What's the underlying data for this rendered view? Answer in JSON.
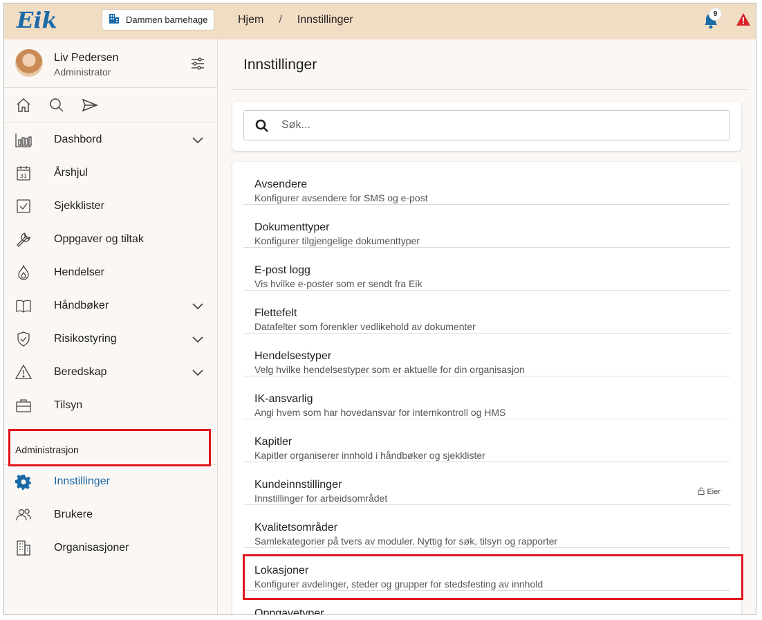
{
  "app": {
    "logo_text": "Eik",
    "organization": "Dammen barnehage",
    "notifications_count": "9"
  },
  "breadcrumb": {
    "home": "Hjem",
    "separator": "/",
    "current": "Innstillinger"
  },
  "user": {
    "name": "Liv Pedersen",
    "role": "Administrator"
  },
  "nav": {
    "items": [
      {
        "label": "Dashbord",
        "icon": "bar-chart-icon",
        "expandable": true
      },
      {
        "label": "Årshjul",
        "icon": "calendar-31-icon",
        "expandable": false
      },
      {
        "label": "Sjekklister",
        "icon": "checkbox-icon",
        "expandable": false
      },
      {
        "label": "Oppgaver og tiltak",
        "icon": "wrench-icon",
        "expandable": false
      },
      {
        "label": "Hendelser",
        "icon": "flame-icon",
        "expandable": false
      },
      {
        "label": "Håndbøker",
        "icon": "book-icon",
        "expandable": true
      },
      {
        "label": "Risikostyring",
        "icon": "shield-check-icon",
        "expandable": true
      },
      {
        "label": "Beredskap",
        "icon": "warning-icon",
        "expandable": true
      },
      {
        "label": "Tilsyn",
        "icon": "briefcase-icon",
        "expandable": false
      }
    ],
    "admin_section_label": "Administrasjon",
    "admin_items": [
      {
        "label": "Innstillinger",
        "icon": "gear-icon",
        "active": true
      },
      {
        "label": "Brukere",
        "icon": "users-icon",
        "active": false
      },
      {
        "label": "Organisasjoner",
        "icon": "building-icon",
        "active": false
      }
    ]
  },
  "main": {
    "title": "Innstillinger",
    "search_placeholder": "Søk...",
    "settings": [
      {
        "title": "Avsendere",
        "subtitle": "Konfigurer avsendere for SMS og e-post"
      },
      {
        "title": "Dokumenttyper",
        "subtitle": "Konfigurer tilgjengelige dokumenttyper"
      },
      {
        "title": "E-post logg",
        "subtitle": "Vis hvilke e-poster som er sendt fra Eik"
      },
      {
        "title": "Flettefelt",
        "subtitle": "Datafelter som forenkler vedlikehold av dokumenter"
      },
      {
        "title": "Hendelsestyper",
        "subtitle": "Velg hvilke hendelsestyper som er aktuelle for din organisasjon"
      },
      {
        "title": "IK-ansvarlig",
        "subtitle": "Angi hvem som har hovedansvar for internkontroll og HMS"
      },
      {
        "title": "Kapitler",
        "subtitle": "Kapitler organiserer innhold i håndbøker og sjekklister"
      },
      {
        "title": "Kundeinnstillinger",
        "subtitle": "Innstillinger for arbeidsområdet",
        "badge": "Eier"
      },
      {
        "title": "Kvalitetsområder",
        "subtitle": "Samlekategorier på tvers av moduler. Nyttig for søk, tilsyn og rapporter"
      },
      {
        "title": "Lokasjoner",
        "subtitle": "Konfigurer avdelinger, steder og grupper for stedsfesting av innhold"
      },
      {
        "title": "Oppgavetyper",
        "subtitle": ""
      }
    ]
  },
  "colors": {
    "topbar": "#f1dcc4",
    "accent": "#1b6aa8",
    "highlight": "#e0141e",
    "warning": "#d8232a"
  }
}
